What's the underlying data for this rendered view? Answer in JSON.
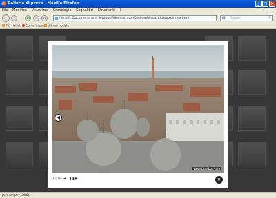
{
  "window": {
    "title": "Galleria di prova - Mozilla Firefox",
    "min": "_",
    "max": "□",
    "close": "×"
  },
  "menu": [
    "File",
    "Modifica",
    "Visualizza",
    "Cronologia",
    "Segnalibri",
    "Strumenti",
    "?"
  ],
  "nav": {
    "back": "‹",
    "forward": "›",
    "reload": "↻",
    "stop": "×",
    "home": "⌂",
    "url": "file:///C:/Documents and Settings/Administrator/Desktop/Visual Lightbox/index.html",
    "star": "☆",
    "search_placeholder": "Google",
    "search_engine": "G",
    "search_go": "⚲"
  },
  "bookmarks": [
    "Più visitati",
    "Come iniziare",
    "Ultime notizie"
  ],
  "lightbox": {
    "counter": "1 / 19",
    "prev_button": "◀",
    "ctrl_prev": "◀",
    "ctrl_pause": "❚❚",
    "ctrl_next": "▶",
    "close_button": "✕",
    "watermark": "visualLightbox.com"
  },
  "status": "javascript:void(0);"
}
